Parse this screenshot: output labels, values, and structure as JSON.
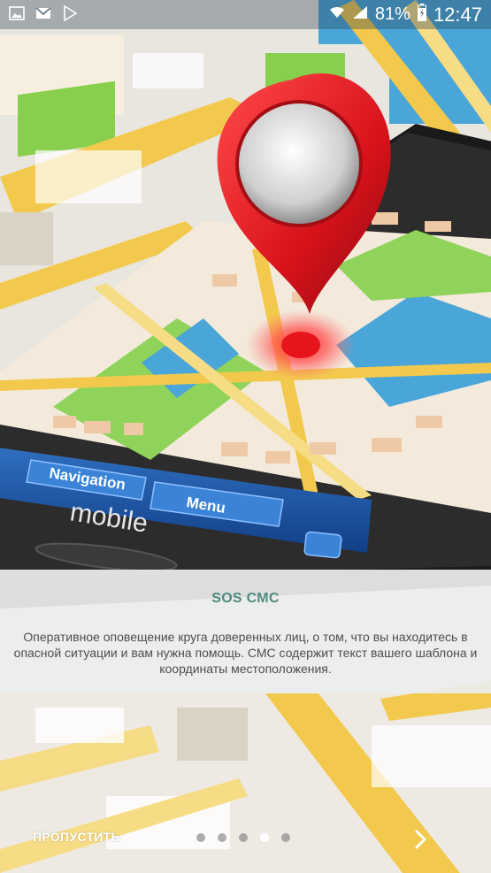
{
  "status_bar": {
    "battery_percent": "81%",
    "time": "12:47",
    "left_icons": [
      "image-icon",
      "gmail-icon",
      "play-store-icon"
    ],
    "right_icons": [
      "wifi-icon",
      "signal-icon",
      "battery-charging-icon"
    ]
  },
  "illustration": {
    "nav_label": "Navigation",
    "menu_label": "Menu",
    "brand_label": "mobile"
  },
  "info": {
    "title": "SOS СМС",
    "body": "Оперативное оповещение круга доверенных лиц, о том, что вы находитесь в опасной ситуации и вам нужна помощь. СМС содержит текст вашего шаблона и координаты местоположения."
  },
  "bottom": {
    "skip_label": "ПРОПУСТИТЬ",
    "page_count": 5,
    "active_page": 4
  },
  "colors": {
    "title": "#4f8a7f",
    "pin": "#d8121b",
    "map_green": "#8fd35a",
    "map_water": "#4aa6d8",
    "road": "#f2c94c"
  }
}
